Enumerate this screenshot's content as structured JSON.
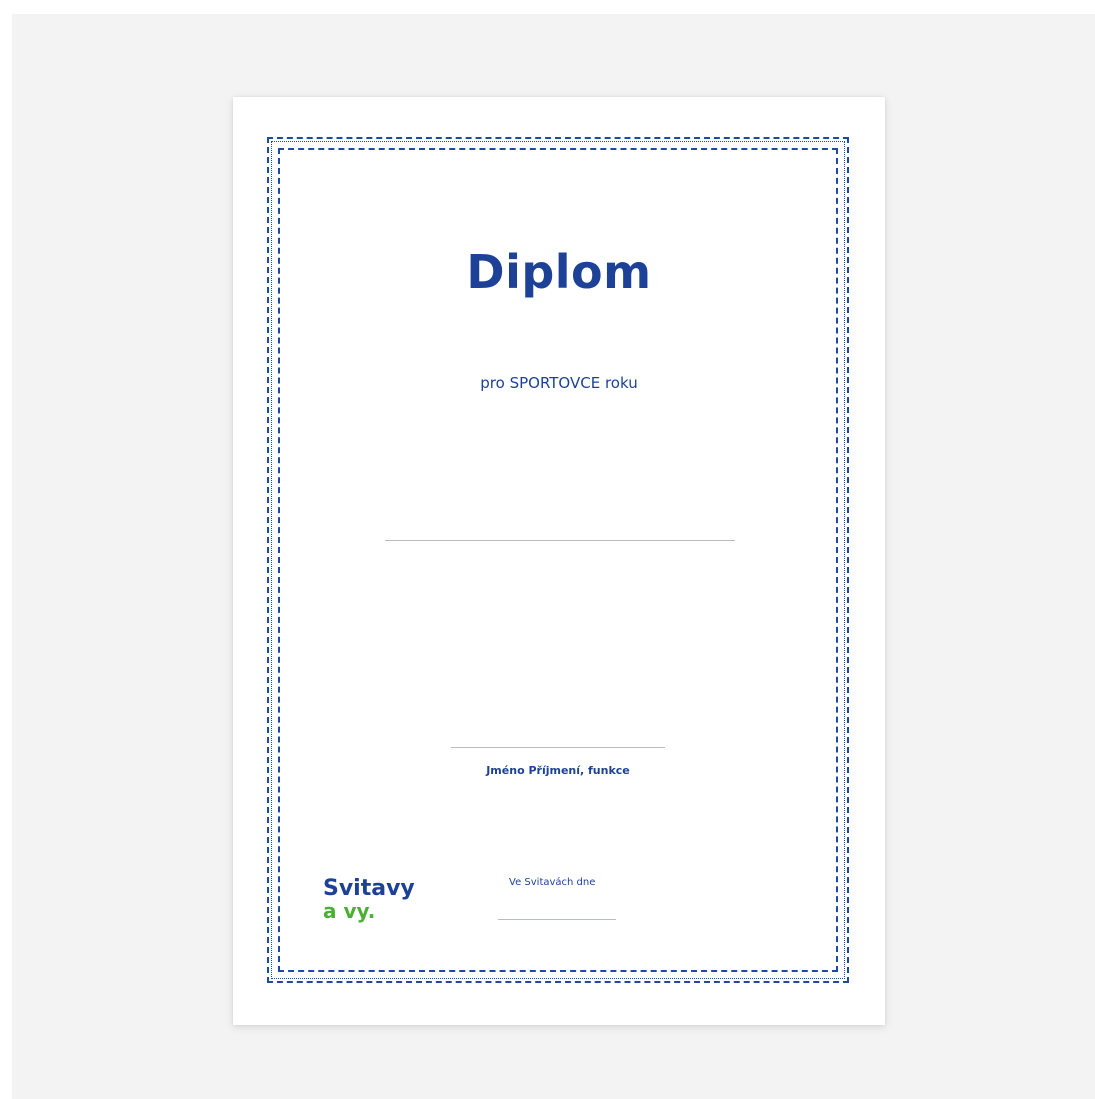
{
  "diploma": {
    "title": "Diplom",
    "subtitle": "pro SPORTOVCE roku",
    "signatory": "Jméno Příjmení, funkce",
    "place_label": "Ve Svitavách dne",
    "logo": {
      "line1": "Svitavy",
      "line2": "a vy."
    }
  },
  "colors": {
    "brand_blue": "#1d4197",
    "brand_green": "#4caf35",
    "border": "#1f4aa3",
    "rule": "#b8bcc4"
  }
}
